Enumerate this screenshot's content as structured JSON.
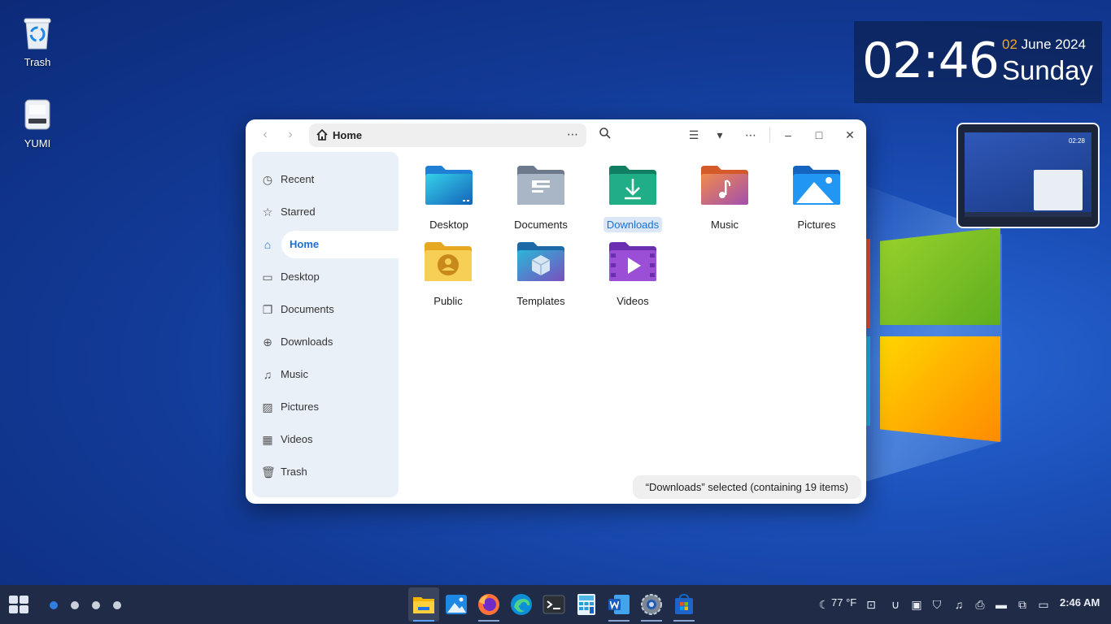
{
  "desktop": {
    "icons": [
      {
        "label": "Trash",
        "icon": "recycle-bin-icon"
      },
      {
        "label": "YUMI",
        "icon": "drive-icon"
      }
    ]
  },
  "clock_widget": {
    "time": "02:46",
    "day_number": "02",
    "month_year": "June 2024",
    "weekday": "Sunday"
  },
  "preview": {
    "mini_time": "02:28"
  },
  "file_manager": {
    "path_label": "Home",
    "path_more": "⋯",
    "toolbar": {
      "back": "‹",
      "forward": "›",
      "search": "⌕",
      "list_view": "☰",
      "view_options": "▾",
      "menu": "⋯",
      "minimize": "–",
      "maximize": "□",
      "close": "✕"
    },
    "sidebar": [
      {
        "label": "Recent",
        "icon": "clock-icon"
      },
      {
        "label": "Starred",
        "icon": "star-icon"
      },
      {
        "label": "Home",
        "icon": "home-icon",
        "active": true
      },
      {
        "label": "Desktop",
        "icon": "desktop-icon"
      },
      {
        "label": "Documents",
        "icon": "documents-icon"
      },
      {
        "label": "Downloads",
        "icon": "download-icon"
      },
      {
        "label": "Music",
        "icon": "music-icon"
      },
      {
        "label": "Pictures",
        "icon": "pictures-icon"
      },
      {
        "label": "Videos",
        "icon": "videos-icon"
      },
      {
        "label": "Trash",
        "icon": "trash-icon"
      }
    ],
    "folders": [
      {
        "label": "Desktop",
        "icon": "desktop-folder-icon"
      },
      {
        "label": "Documents",
        "icon": "documents-folder-icon"
      },
      {
        "label": "Downloads",
        "icon": "downloads-folder-icon",
        "selected": true
      },
      {
        "label": "Music",
        "icon": "music-folder-icon"
      },
      {
        "label": "Pictures",
        "icon": "pictures-folder-icon"
      },
      {
        "label": "Public",
        "icon": "public-folder-icon"
      },
      {
        "label": "Templates",
        "icon": "templates-folder-icon"
      },
      {
        "label": "Videos",
        "icon": "videos-folder-icon"
      }
    ],
    "status": "“Downloads” selected  (containing 19 items)"
  },
  "taskbar": {
    "apps": [
      {
        "name": "Files",
        "icon": "files-app-icon",
        "active": true
      },
      {
        "name": "Image Viewer",
        "icon": "image-viewer-icon"
      },
      {
        "name": "Firefox",
        "icon": "firefox-icon"
      },
      {
        "name": "Edge",
        "icon": "edge-icon"
      },
      {
        "name": "Terminal",
        "icon": "terminal-icon"
      },
      {
        "name": "Calculator",
        "icon": "calculator-icon"
      },
      {
        "name": "Word",
        "icon": "word-icon"
      },
      {
        "name": "Settings",
        "icon": "settings-icon"
      },
      {
        "name": "Store",
        "icon": "store-icon"
      }
    ],
    "weather": "77 °F",
    "clock": "2:46 AM",
    "colors": {
      "accent": "#1a6fd6",
      "taskbar": "#1f2b47"
    }
  }
}
